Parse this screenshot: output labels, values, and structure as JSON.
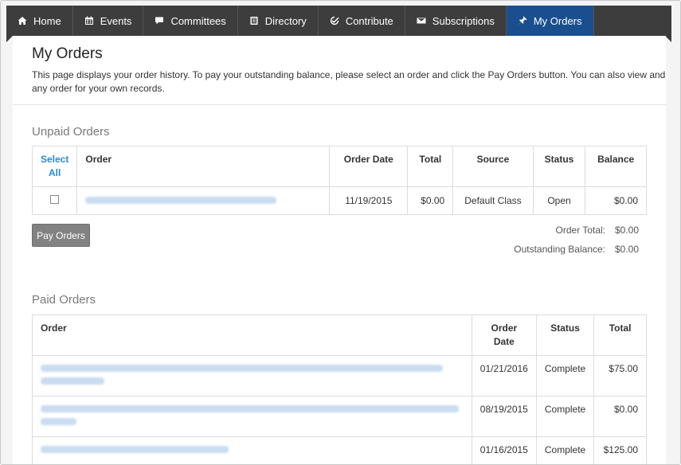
{
  "nav": {
    "items": [
      {
        "label": "Home",
        "icon": "home-icon"
      },
      {
        "label": "Events",
        "icon": "calendar-icon"
      },
      {
        "label": "Committees",
        "icon": "chat-icon"
      },
      {
        "label": "Directory",
        "icon": "book-icon"
      },
      {
        "label": "Contribute",
        "icon": "check-icon"
      },
      {
        "label": "Subscriptions",
        "icon": "envelope-icon"
      },
      {
        "label": "My Orders",
        "icon": "pin-icon"
      }
    ],
    "active": "My Orders",
    "active_color": "#1a4f8f"
  },
  "page": {
    "title": "My Orders",
    "description": "This page displays your order history. To pay your outstanding balance, please select an order and click the Pay Orders button. You can also view and print any order for your own records."
  },
  "unpaid": {
    "title": "Unpaid Orders",
    "headers": {
      "select_all": "Select All",
      "order": "Order",
      "order_date": "Order Date",
      "total": "Total",
      "source": "Source",
      "status": "Status",
      "balance": "Balance"
    },
    "rows": [
      {
        "order_date": "11/19/2015",
        "total": "$0.00",
        "source": "Default Class",
        "status": "Open",
        "balance": "$0.00"
      }
    ],
    "pay_button": "Pay Orders",
    "order_total_label": "Order Total:",
    "order_total_value": "$0.00",
    "outstanding_label": "Outstanding Balance:",
    "outstanding_value": "$0.00"
  },
  "paid": {
    "title": "Paid Orders",
    "headers": {
      "order": "Order",
      "order_date": "Order Date",
      "status": "Status",
      "total": "Total"
    },
    "rows": [
      {
        "order_date": "01/21/2016",
        "status": "Complete",
        "total": "$75.00"
      },
      {
        "order_date": "08/19/2015",
        "status": "Complete",
        "total": "$0.00"
      },
      {
        "order_date": "01/16/2015",
        "status": "Complete",
        "total": "$125.00"
      }
    ]
  }
}
